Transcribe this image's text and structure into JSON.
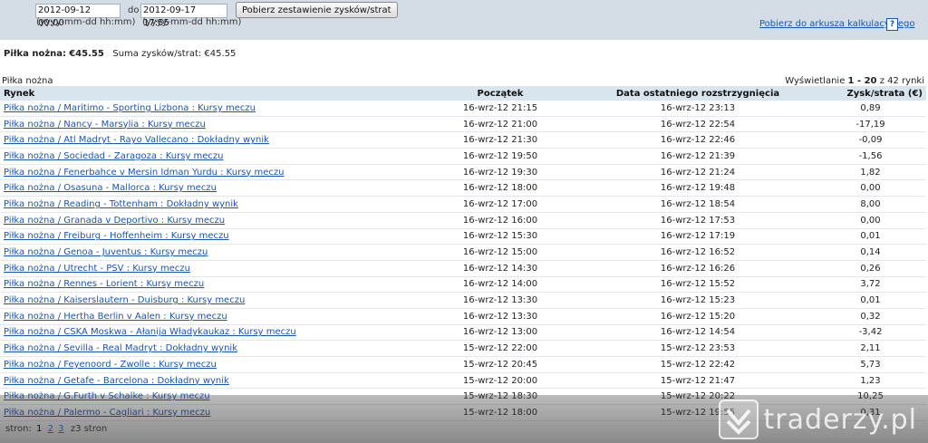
{
  "filter": {
    "date_from": "2012-09-12 00:00",
    "date_to": "2012-09-17 17:55",
    "date_hint": "(yyyy-mm-dd hh:mm)",
    "to_label": "do",
    "submit_label": "Pobierz zestawienie zysków/strat"
  },
  "export": {
    "link_label": "Pobierz do arkusza kalkulacyjnego",
    "help_label": "?"
  },
  "summary": {
    "sport_label": "Piłka nożna:",
    "sport_value": "€45.55",
    "total_label": "Suma zysków/strat:",
    "total_value": "€45.55"
  },
  "table_caption": "Piłka nożna",
  "paging": {
    "prefix": "Wyświetlanie",
    "range": "1 - 20",
    "suffix": "z 42 rynki"
  },
  "columns": {
    "market": "Rynek",
    "start": "Początek",
    "settled": "Data ostatniego rozstrzygnięcia",
    "pl": "Zysk/strata (€)"
  },
  "rows": [
    {
      "market": "Piłka nożna / Maritimo - Sporting Lizbona : Kursy meczu",
      "start": "16-wrz-12 21:15",
      "settled": "16-wrz-12 23:13",
      "pl": "0,89"
    },
    {
      "market": "Piłka nożna / Nancy - Marsylia : Kursy meczu",
      "start": "16-wrz-12 21:00",
      "settled": "16-wrz-12 22:54",
      "pl": "-17,19"
    },
    {
      "market": "Piłka nożna / Atl Madryt - Rayo Vallecano : Dokładny wynik",
      "start": "16-wrz-12 21:30",
      "settled": "16-wrz-12 22:46",
      "pl": "-0,09"
    },
    {
      "market": "Piłka nożna / Sociedad - Zaragoza : Kursy meczu",
      "start": "16-wrz-12 19:50",
      "settled": "16-wrz-12 21:39",
      "pl": "-1,56"
    },
    {
      "market": "Piłka nożna / Fenerbahce v Mersin Idman Yurdu : Kursy meczu",
      "start": "16-wrz-12 19:30",
      "settled": "16-wrz-12 21:24",
      "pl": "1,82"
    },
    {
      "market": "Piłka nożna / Osasuna - Mallorca : Kursy meczu",
      "start": "16-wrz-12 18:00",
      "settled": "16-wrz-12 19:48",
      "pl": "0,00"
    },
    {
      "market": "Piłka nożna / Reading - Tottenham : Dokładny wynik",
      "start": "16-wrz-12 17:00",
      "settled": "16-wrz-12 18:54",
      "pl": "8,00"
    },
    {
      "market": "Piłka nożna / Granada v Deportivo : Kursy meczu",
      "start": "16-wrz-12 16:00",
      "settled": "16-wrz-12 17:53",
      "pl": "0,00"
    },
    {
      "market": "Piłka nożna / Freiburg - Hoffenheim : Kursy meczu",
      "start": "16-wrz-12 15:30",
      "settled": "16-wrz-12 17:19",
      "pl": "0,01"
    },
    {
      "market": "Piłka nożna / Genoa - Juventus : Kursy meczu",
      "start": "16-wrz-12 15:00",
      "settled": "16-wrz-12 16:52",
      "pl": "0,14"
    },
    {
      "market": "Piłka nożna / Utrecht - PSV : Kursy meczu",
      "start": "16-wrz-12 14:30",
      "settled": "16-wrz-12 16:26",
      "pl": "0,26"
    },
    {
      "market": "Piłka nożna / Rennes - Lorient : Kursy meczu",
      "start": "16-wrz-12 14:00",
      "settled": "16-wrz-12 15:52",
      "pl": "3,72"
    },
    {
      "market": "Piłka nożna / Kaiserslautern - Duisburg : Kursy meczu",
      "start": "16-wrz-12 13:30",
      "settled": "16-wrz-12 15:23",
      "pl": "0,01"
    },
    {
      "market": "Piłka nożna / Hertha Berlin v Aalen : Kursy meczu",
      "start": "16-wrz-12 13:30",
      "settled": "16-wrz-12 15:20",
      "pl": "0,32"
    },
    {
      "market": "Piłka nożna / CSKA Moskwa - Ałanija Władykaukaz : Kursy meczu",
      "start": "16-wrz-12 13:00",
      "settled": "16-wrz-12 14:54",
      "pl": "-3,42"
    },
    {
      "market": "Piłka nożna / Sevilla - Real Madryt : Dokładny wynik",
      "start": "15-wrz-12 22:00",
      "settled": "15-wrz-12 23:53",
      "pl": "2,11"
    },
    {
      "market": "Piłka nożna / Feyenoord - Zwolle : Kursy meczu",
      "start": "15-wrz-12 20:45",
      "settled": "15-wrz-12 22:42",
      "pl": "5,73"
    },
    {
      "market": "Piłka nożna / Getafe - Barcelona : Dokładny wynik",
      "start": "15-wrz-12 20:00",
      "settled": "15-wrz-12 21:47",
      "pl": "1,23"
    },
    {
      "market": "Piłka nożna / G.Furth v Schalke : Kursy meczu",
      "start": "15-wrz-12 18:30",
      "settled": "15-wrz-12 20:22",
      "pl": "10,25"
    },
    {
      "market": "Piłka nożna / Palermo - Cagliari : Kursy meczu",
      "start": "15-wrz-12 18:00",
      "settled": "15-wrz-12 19:55",
      "pl": "0,31"
    }
  ],
  "pager": {
    "label": "stron:",
    "current": "1",
    "pages": [
      "2",
      "3"
    ],
    "total": "z3 stron"
  },
  "watermark": {
    "icon": "traderzy-logo-icon",
    "text": "traderzy.pl"
  }
}
